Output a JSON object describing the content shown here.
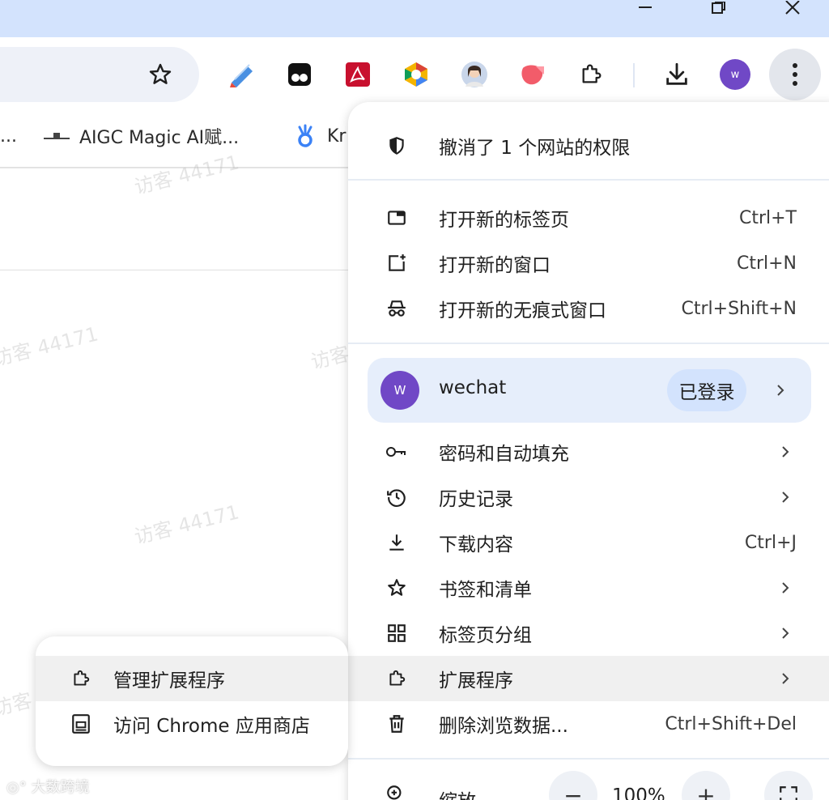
{
  "titlebar": {
    "minimize_icon": "minimize-icon",
    "restore_icon": "restore-icon",
    "close_icon": "close-icon"
  },
  "toolbar": {
    "extensions": [
      "pencil-extension-icon",
      "tampermonkey-extension-icon",
      "adobe-pdf-extension-icon",
      "multicolor-extension-icon",
      "avatar-extension-icon",
      "red-shape-extension-icon",
      "puzzle-extensions-icon"
    ],
    "download_icon": "download-icon",
    "profile_initial": "w",
    "menu_icon": "kebab-menu-icon"
  },
  "bookmarks": [
    {
      "label": "..."
    },
    {
      "label": "AIGC Magic AI赋..."
    },
    {
      "label": "Kr"
    }
  ],
  "watermark": "访客 44171",
  "menu": {
    "permission_notice": "撤消了 1 个网站的权限",
    "group1": [
      {
        "label": "打开新的标签页",
        "shortcut": "Ctrl+T",
        "icon": "new-tab-icon"
      },
      {
        "label": "打开新的窗口",
        "shortcut": "Ctrl+N",
        "icon": "new-window-icon"
      },
      {
        "label": "打开新的无痕式窗口",
        "shortcut": "Ctrl+Shift+N",
        "icon": "incognito-icon"
      }
    ],
    "profile": {
      "initial": "W",
      "name": "wechat",
      "status": "已登录"
    },
    "group2": [
      {
        "label": "密码和自动填充",
        "icon": "key-icon"
      },
      {
        "label": "历史记录",
        "icon": "history-icon"
      },
      {
        "label": "下载内容",
        "shortcut": "Ctrl+J",
        "icon": "download-icon"
      },
      {
        "label": "书签和清单",
        "icon": "star-icon"
      },
      {
        "label": "标签页分组",
        "icon": "grid-icon"
      },
      {
        "label": "扩展程序",
        "icon": "puzzle-icon"
      },
      {
        "label": "删除浏览数据...",
        "shortcut": "Ctrl+Shift+Del",
        "icon": "trash-icon"
      }
    ],
    "zoom": {
      "label": "缩放",
      "minus": "−",
      "value": "100%",
      "plus": "+"
    }
  },
  "submenu": [
    {
      "label": "管理扩展程序",
      "icon": "puzzle-icon"
    },
    {
      "label": "访问 Chrome 应用商店",
      "icon": "store-icon"
    }
  ],
  "footer": "大数跨境"
}
